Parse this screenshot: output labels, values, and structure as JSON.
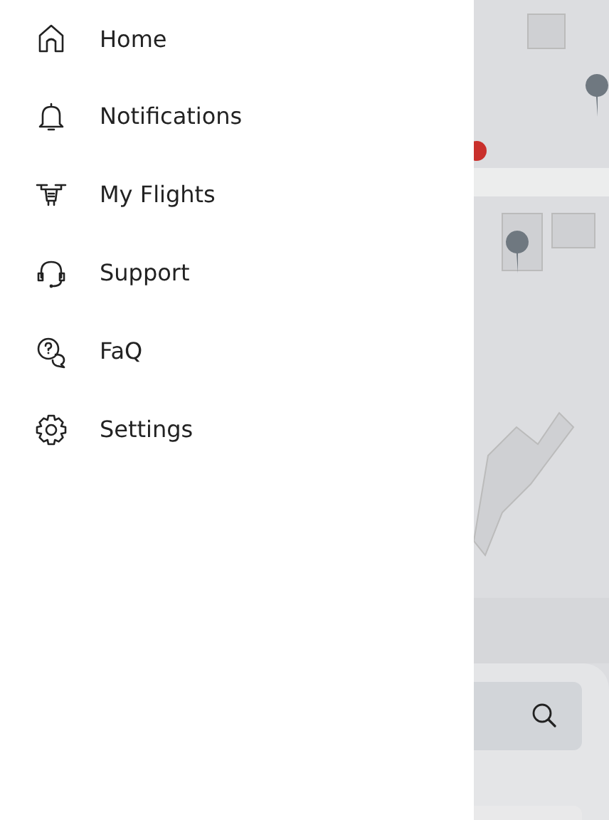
{
  "drawer": {
    "items": [
      {
        "label": "Home"
      },
      {
        "label": "Notifications"
      },
      {
        "label": "My Flights"
      },
      {
        "label": "Support"
      },
      {
        "label": "FaQ"
      },
      {
        "label": "Settings"
      }
    ]
  }
}
